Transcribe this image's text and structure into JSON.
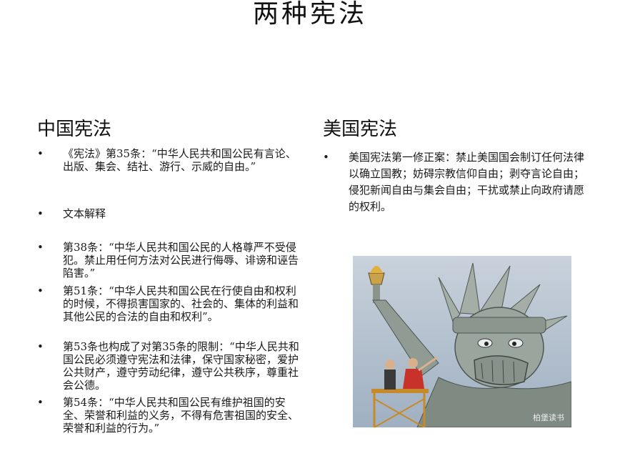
{
  "title": "两种宪法",
  "china": {
    "heading": "中国宪法",
    "items": [
      "《宪法》第35条：“中华人民共和国公民有言论、出版、集会、结社、游行、示威的自由。”",
      "文本解释",
      "第38条：“中华人民共和国公民的人格尊严不受侵犯。禁止用任何方法对公民进行侮辱、诽谤和诬告陷害。”",
      "第51条：“中华人民共和国公民在行使自由和权利的时候，不得损害国家的、社会的、集体的利益和其他公民的合法的自由和权利”。",
      "第53条也构成了对第35条的限制：“中华人民共和国公民必须遵守宪法和法律，保守国家秘密，爱护公共财产，遵守劳动纪律，遵守公共秩序，尊重社会公德。",
      "第54条：“中华人民共和国公民有维护祖国的安全、荣誉和利益的义务，不得有危害祖国的安全、荣誉和利益的行为。”"
    ]
  },
  "usa": {
    "heading": "美国宪法",
    "items": [
      "美国宪法第一修正案：禁止美国国会制订任何法律以确立国教；妨碍宗教信仰自由；剥夺言论自由；侵犯新闻自由与集会自由；干扰或禁止向政府请愿的权利。"
    ]
  },
  "image": {
    "watermark": "柏堡读书"
  }
}
